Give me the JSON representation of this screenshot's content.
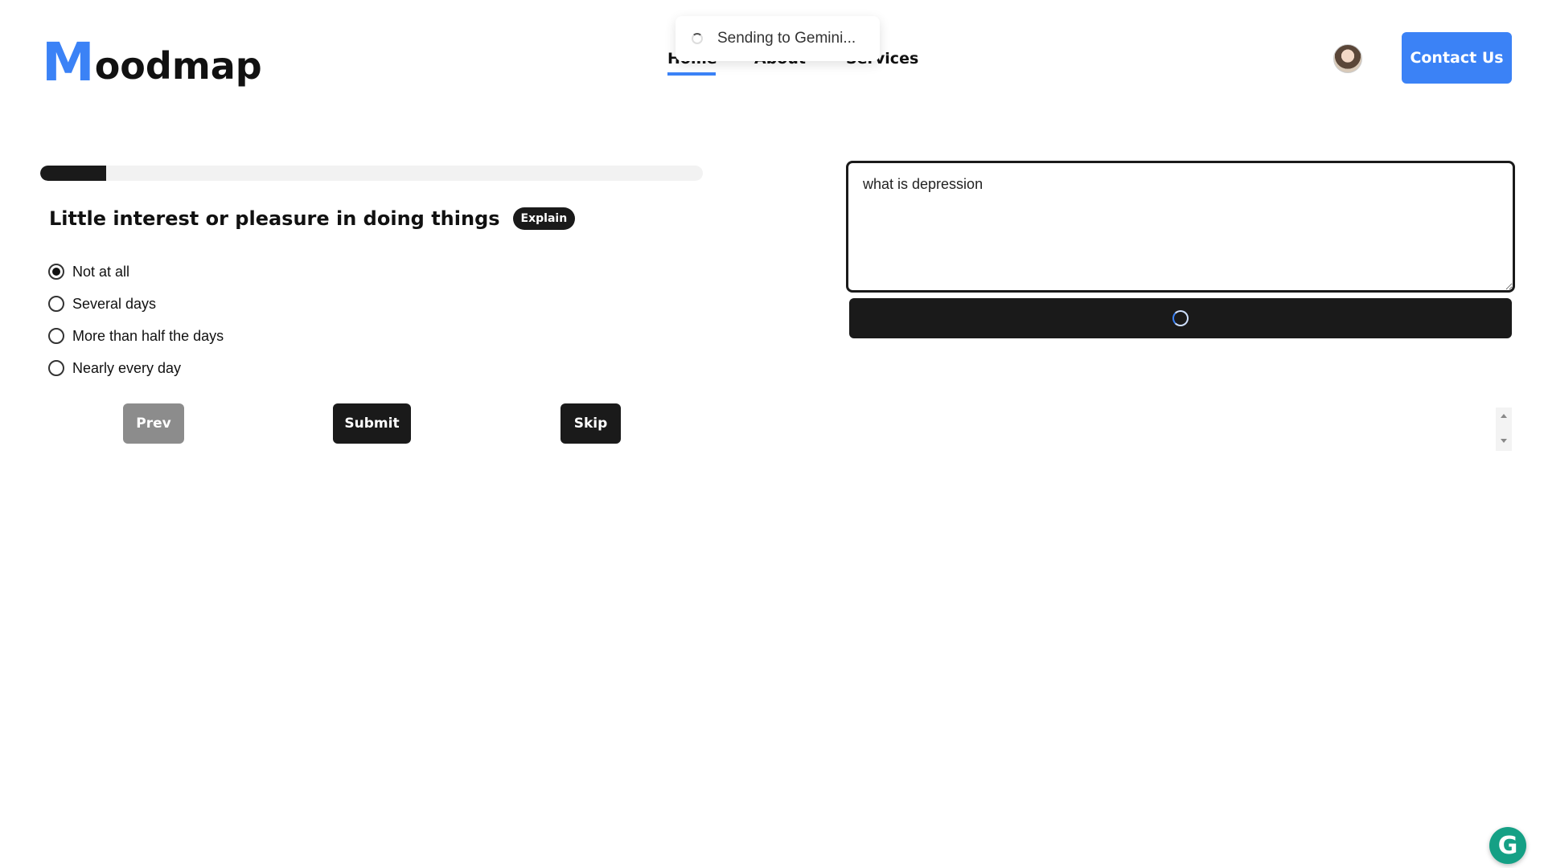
{
  "header": {
    "logo_first": "M",
    "logo_rest": "oodmap",
    "nav": [
      {
        "label": "Home",
        "active": true
      },
      {
        "label": "About"
      },
      {
        "label": "Services"
      }
    ],
    "contact_label": "Contact Us"
  },
  "toast": {
    "text": "Sending to Gemini..."
  },
  "quiz": {
    "progress_fraction": 0.1,
    "question": "Little interest or pleasure in doing things",
    "explain_label": "Explain",
    "options": [
      {
        "label": "Not at all",
        "selected": true
      },
      {
        "label": "Several days",
        "selected": false
      },
      {
        "label": "More than half the days",
        "selected": false
      },
      {
        "label": "Nearly every day",
        "selected": false
      }
    ],
    "prev_label": "Prev",
    "submit_label": "Submit",
    "skip_label": "Skip"
  },
  "chat": {
    "input_value": "what is depression"
  },
  "colors": {
    "accent": "#3b82f6",
    "dark": "#1a1a1a",
    "disabled": "#8c8c8c"
  },
  "icons": {
    "toast_spinner": "loading-spinner-icon",
    "send_spinner": "loading-spinner-icon",
    "grammarly": "grammarly-icon"
  }
}
